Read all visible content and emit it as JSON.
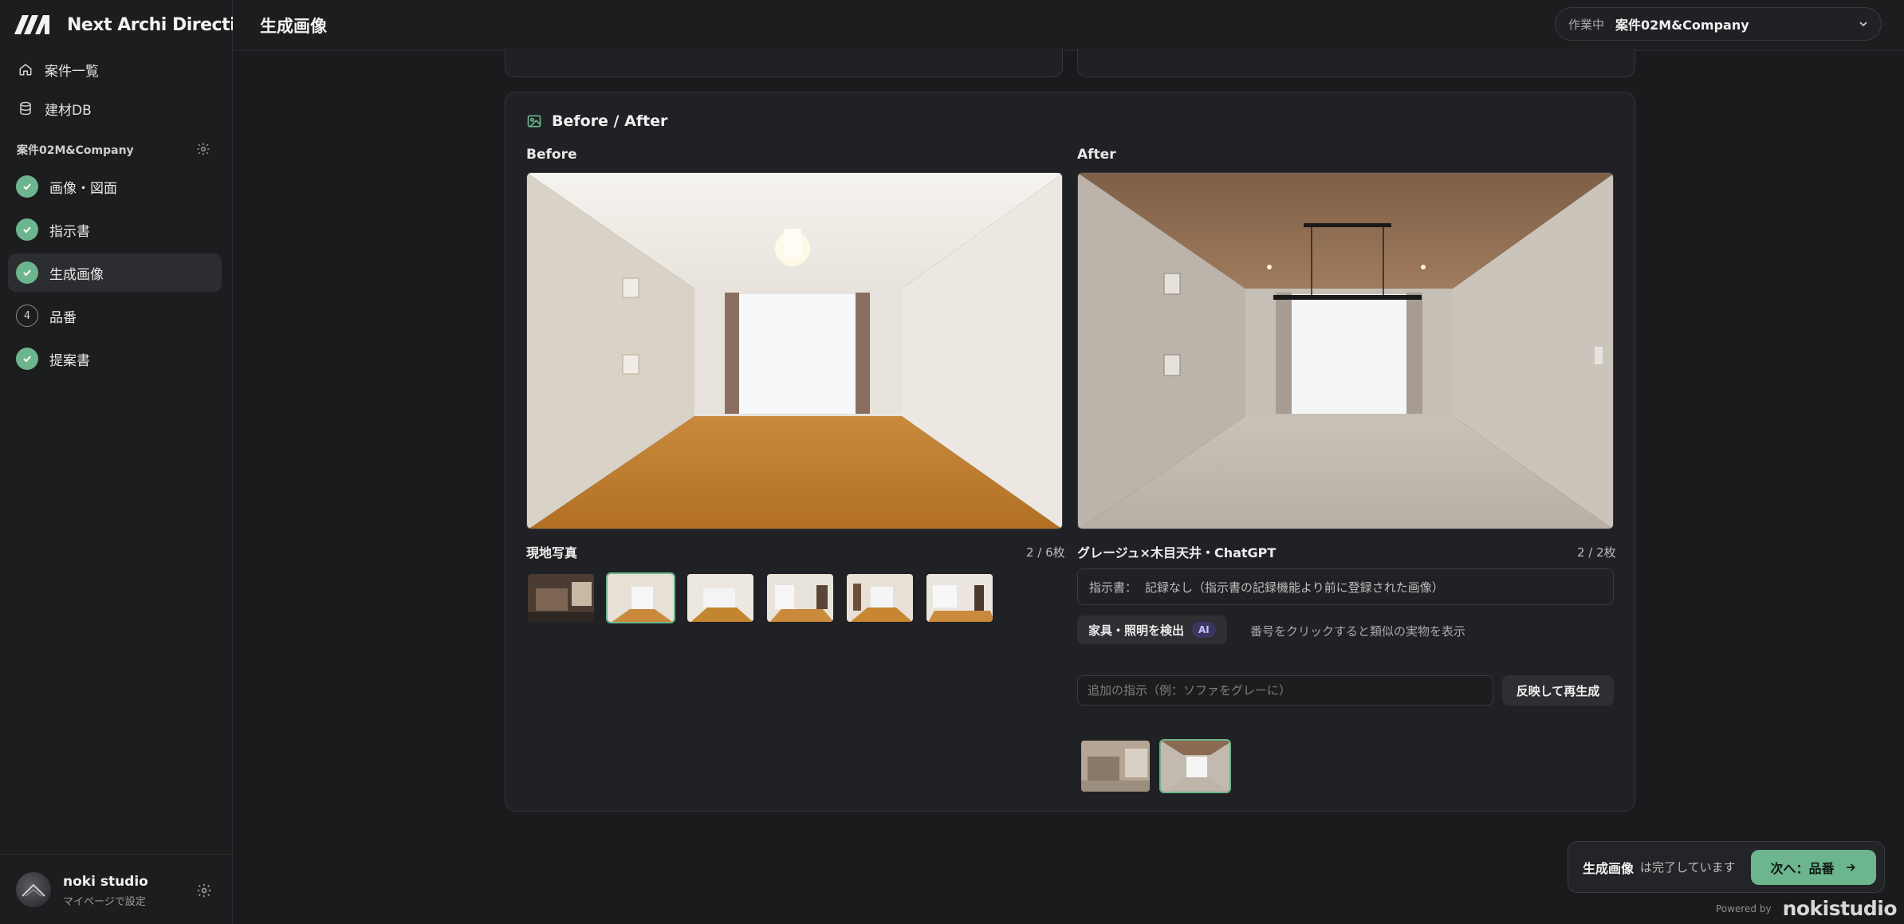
{
  "app": {
    "brand": "Next Archi Direction"
  },
  "sidebar": {
    "nav": [
      {
        "label": "案件一覧",
        "icon": "home-icon"
      },
      {
        "label": "建材DB",
        "icon": "database-icon"
      }
    ],
    "project_label": "案件02M&Company",
    "steps": [
      {
        "label": "画像・図面",
        "status": "done"
      },
      {
        "label": "指示書",
        "status": "done"
      },
      {
        "label": "生成画像",
        "status": "done",
        "active": true
      },
      {
        "label": "品番",
        "status": "pending",
        "number": "4"
      },
      {
        "label": "提案書",
        "status": "done"
      }
    ],
    "user": {
      "name": "noki studio",
      "sub": "マイページで設定"
    }
  },
  "header": {
    "title": "生成画像",
    "workspace_label": "作業中",
    "workspace_value": "案件02M&Company"
  },
  "card": {
    "title": "Before / After",
    "before": {
      "label": "Before",
      "section": "現地写真",
      "count": "2 / 6枚",
      "thumbs": 6,
      "selected": 1
    },
    "after": {
      "label": "After",
      "section": "グレージュ×木目天井・ChatGPT",
      "count": "2 / 2枚",
      "instruction_label": "指示書：",
      "instruction_value": "記録なし（指示書の記録機能より前に登録された画像）",
      "detect_button": "家具・照明を検出",
      "ai_badge": "AI",
      "detect_hint": "番号をクリックすると類似の実物を表示",
      "add_placeholder": "追加の指示（例：ソファをグレーに）",
      "regen_button": "反映して再生成",
      "thumbs": 2,
      "selected": 1
    }
  },
  "toast": {
    "strong": "生成画像",
    "rest": "は完了しています",
    "next_button": "次へ：品番"
  },
  "footer": {
    "powered_by": "Powered by",
    "brand": "nokistudio"
  },
  "colors": {
    "accent": "#6cb58e",
    "bg": "#1a1b1d",
    "card": "#202124"
  }
}
